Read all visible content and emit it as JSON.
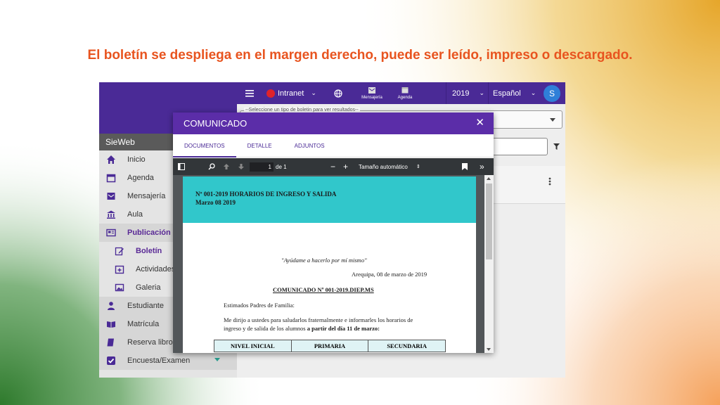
{
  "slide": {
    "title": "El boletín se despliega en el margen derecho, puede ser leído, impreso o descargado."
  },
  "colors": {
    "purple": "#4a2a96",
    "title_orange": "#e8541f",
    "teal": "#31c7cb"
  },
  "topbar": {
    "intranet_label": "Intranet",
    "mensajeria_label": "Mensajería",
    "agenda_label": "Agenda",
    "year": "2019",
    "language": "Español",
    "avatar_letter": "S"
  },
  "sidebar": {
    "brand": "SieWeb",
    "items": [
      {
        "label": "Inicio",
        "icon": "home-icon"
      },
      {
        "label": "Agenda",
        "icon": "calendar-icon"
      },
      {
        "label": "Mensajería",
        "icon": "mail-icon"
      },
      {
        "label": "Aula",
        "icon": "institution-icon"
      },
      {
        "label": "Publicación",
        "icon": "newspaper-icon"
      },
      {
        "label": "Boletín",
        "icon": "edit-icon"
      },
      {
        "label": "Actividades",
        "icon": "calendar-plus-icon"
      },
      {
        "label": "Galeria",
        "icon": "image-icon"
      },
      {
        "label": "Estudiante",
        "icon": "student-icon"
      },
      {
        "label": "Matrícula",
        "icon": "book-open-icon"
      },
      {
        "label": "Reserva libro",
        "icon": "book-icon"
      },
      {
        "label": "Encuesta/Examen",
        "icon": "checkbox-icon"
      }
    ]
  },
  "content": {
    "select_placeholder": "--Seleccione un tipo de boletin para ver resultados--"
  },
  "modal": {
    "title": "COMUNICADO",
    "tabs": [
      "DOCUMENTOS",
      "DETALLE",
      "ADJUNTOS"
    ],
    "viewer": {
      "page_current": "1",
      "page_total": "de 1",
      "zoom": "Tamaño automático"
    },
    "document": {
      "header_line1": "Nº 001-2019 HORARIOS DE INGRESO Y SALIDA",
      "header_line2": "Marzo 08 2019",
      "quote": "\"Ayúdame a hacerlo por mí mismo\"",
      "place_date": "Arequipa, 08 de marzo de 2019",
      "reference": "COMUNICADO Nº 001-2019.DIEP.MS",
      "greeting": "Estimados Padres de Familia:",
      "body_line1": "Me dirijo a ustedes para saludarlos fraternalmente e informarles los horarios de",
      "body_line2a": "ingreso y de salida de los alumnos ",
      "body_line2b": "a partir del día 11 de marzo:",
      "levels": [
        "NIVEL INICIAL",
        "PRIMARIA",
        "SECUNDARIA"
      ]
    }
  }
}
